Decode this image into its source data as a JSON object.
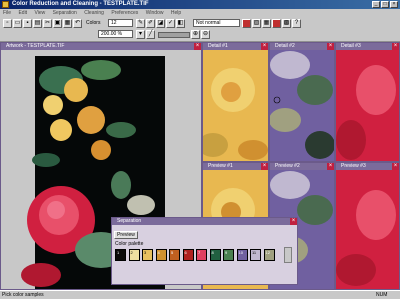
{
  "app": {
    "title": "Color Reduction and Cleaning - TESTPLATE.TIF"
  },
  "menu": [
    "File",
    "Edit",
    "View",
    "Separation",
    "Cleaning",
    "Preferences",
    "Window",
    "Help"
  ],
  "toolbar": {
    "colors_label": "Colors",
    "colors_value": "12",
    "zoom_value": "200.00 %",
    "mode_value": "Not normal"
  },
  "windows": {
    "artwork": "Artwork - TESTPLATE.TIF",
    "detail1": "Detail #1",
    "detail2": "Detail #2",
    "detail3": "Detail #3",
    "preview1": "Preview #1",
    "preview2": "Preview #2",
    "preview3": "Preview #3"
  },
  "separation": {
    "title": "Separation",
    "preview_button": "Preview",
    "palette_label": "Color palette",
    "swatches": [
      {
        "n": "1",
        "color": "#0a0a0a"
      },
      {
        "n": "2",
        "color": "#f0e0a0"
      },
      {
        "n": "3",
        "color": "#e8c060"
      },
      {
        "n": "4",
        "color": "#d09030"
      },
      {
        "n": "5",
        "color": "#c06020"
      },
      {
        "n": "6",
        "color": "#b02020"
      },
      {
        "n": "7",
        "color": "#e04060"
      },
      {
        "n": "8",
        "color": "#206040"
      },
      {
        "n": "9",
        "color": "#4a8050"
      },
      {
        "n": "10",
        "color": "#7060a0"
      },
      {
        "n": "11",
        "color": "#c0b8d0"
      },
      {
        "n": "12",
        "color": "#a0a080"
      }
    ]
  },
  "status": {
    "left": "Pick color samples",
    "right": "NUM"
  }
}
